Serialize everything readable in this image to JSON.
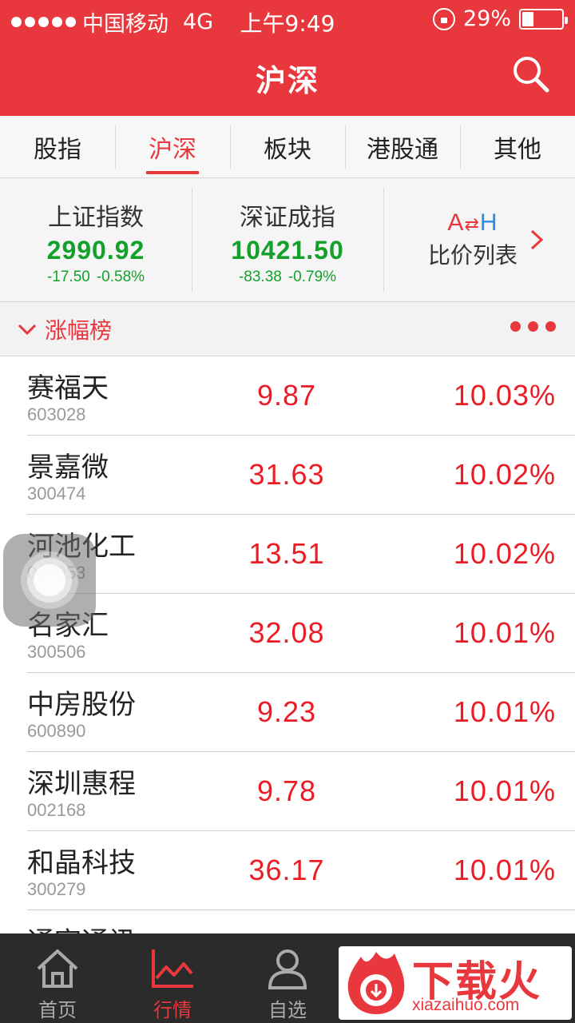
{
  "status_bar": {
    "carrier": "中国移动",
    "network": "4G",
    "time": "上午9:49",
    "battery": "29%",
    "battery_level": 0.29
  },
  "nav": {
    "title": "沪深",
    "search_icon": "search-icon"
  },
  "tabs": [
    {
      "label": "股指",
      "active": false
    },
    {
      "label": "沪深",
      "active": true
    },
    {
      "label": "板块",
      "active": false
    },
    {
      "label": "港股通",
      "active": false
    },
    {
      "label": "其他",
      "active": false
    }
  ],
  "indices": [
    {
      "name": "上证指数",
      "value": "2990.92",
      "change": "-17.50",
      "change_pct": "-0.58%"
    },
    {
      "name": "深证成指",
      "value": "10421.50",
      "change": "-83.38",
      "change_pct": "-0.79%"
    }
  ],
  "ah_card": {
    "logo_a": "A",
    "logo_arrows": "⇄",
    "logo_h": "H",
    "label": "比价列表"
  },
  "section": {
    "title": "涨幅榜"
  },
  "stocks": [
    {
      "name": "赛福天",
      "code": "603028",
      "price": "9.87",
      "pct": "10.03%"
    },
    {
      "name": "景嘉微",
      "code": "300474",
      "price": "31.63",
      "pct": "10.02%"
    },
    {
      "name": "河池化工",
      "code": "000953",
      "price": "13.51",
      "pct": "10.02%"
    },
    {
      "name": "名家汇",
      "code": "300506",
      "price": "32.08",
      "pct": "10.01%"
    },
    {
      "name": "中房股份",
      "code": "600890",
      "price": "9.23",
      "pct": "10.01%"
    },
    {
      "name": "深圳惠程",
      "code": "002168",
      "price": "9.78",
      "pct": "10.01%"
    },
    {
      "name": "和晶科技",
      "code": "300279",
      "price": "36.17",
      "pct": "10.01%"
    },
    {
      "name": "通宇通讯",
      "code": "",
      "price": "",
      "pct": ""
    }
  ],
  "bottom_tabs": [
    {
      "label": "首页",
      "icon": "home-icon",
      "active": false
    },
    {
      "label": "行情",
      "icon": "chart-icon",
      "active": true
    },
    {
      "label": "自选",
      "icon": "user-icon",
      "active": false
    }
  ],
  "watermark": {
    "text": "下载火",
    "url": "xiazaihuo.com"
  },
  "colors": {
    "brand_red": "#e8383d",
    "up_red": "#ec1c24",
    "down_green": "#13a12b",
    "tabbar_bg": "#2b2b2b"
  }
}
